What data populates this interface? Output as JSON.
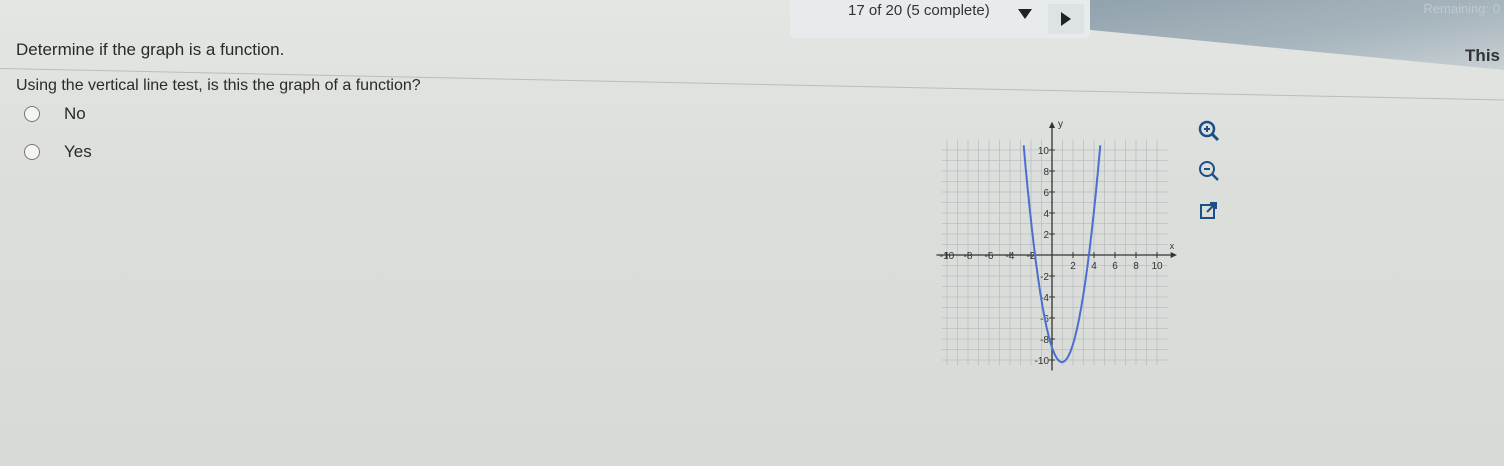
{
  "header": {
    "progress": "17 of 20 (5 complete)",
    "remaining": "Remaining: 0",
    "side_label": "This"
  },
  "question": {
    "title": "Determine if the graph is a function.",
    "prompt": "Using the vertical line test, is this the graph of a function?",
    "options": [
      {
        "label": "No",
        "selected": false
      },
      {
        "label": "Yes",
        "selected": false
      }
    ]
  },
  "graph": {
    "x_axis_label": "x",
    "y_axis_label": "y",
    "x_ticks": [
      "-10",
      "-8",
      "-6",
      "-4",
      "-2",
      "2",
      "4",
      "6",
      "8",
      "10"
    ],
    "y_ticks": [
      "10",
      "8",
      "6",
      "4",
      "2",
      "-2",
      "-4",
      "-6",
      "-8",
      "-10"
    ],
    "curve_color": "#4a6fd0"
  },
  "tools": {
    "zoom_in": "zoom-in-icon",
    "zoom_out": "zoom-out-icon",
    "popout": "external-link-icon"
  }
}
